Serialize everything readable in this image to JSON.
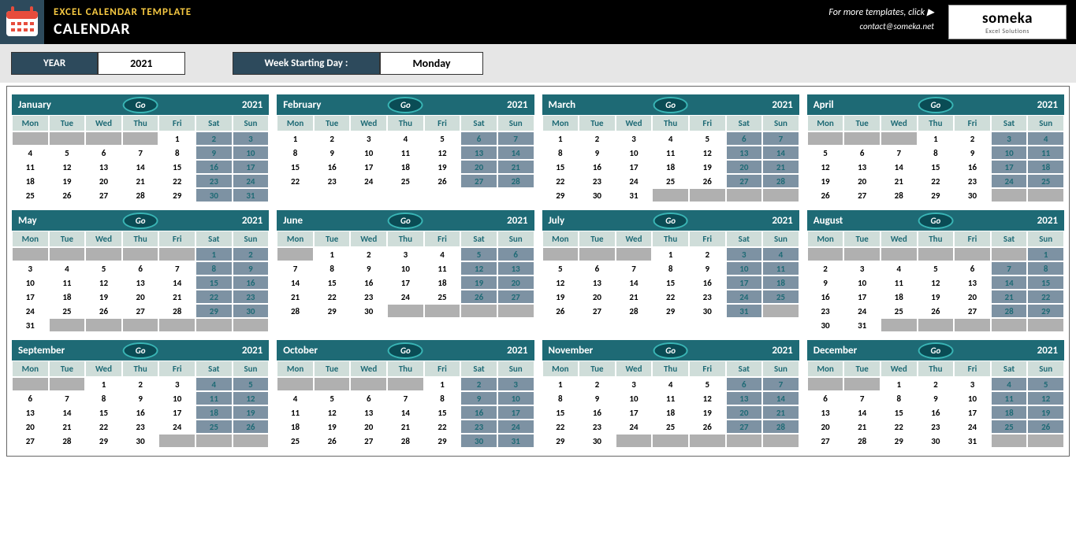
{
  "header": {
    "app_title": "EXCEL CALENDAR TEMPLATE",
    "page_title": "CALENDAR",
    "more_text": "For more templates, click ▶",
    "contact": "contact@someka.net",
    "brand_name": "someka",
    "brand_sub": "Excel Solutions"
  },
  "controls": {
    "year_label": "YEAR",
    "year_value": "2021",
    "weekstart_label": "Week Starting Day :",
    "weekstart_value": "Monday"
  },
  "go_label": "Go",
  "dow": [
    "Mon",
    "Tue",
    "Wed",
    "Thu",
    "Fri",
    "Sat",
    "Sun"
  ],
  "weekend_indices": [
    5,
    6
  ],
  "months": [
    {
      "name": "January",
      "year": "2021",
      "start": 4,
      "days": 31
    },
    {
      "name": "February",
      "year": "2021",
      "start": 0,
      "days": 28
    },
    {
      "name": "March",
      "year": "2021",
      "start": 0,
      "days": 31
    },
    {
      "name": "April",
      "year": "2021",
      "start": 3,
      "days": 30
    },
    {
      "name": "May",
      "year": "2021",
      "start": 5,
      "days": 31
    },
    {
      "name": "June",
      "year": "2021",
      "start": 1,
      "days": 30
    },
    {
      "name": "July",
      "year": "2021",
      "start": 3,
      "days": 31
    },
    {
      "name": "August",
      "year": "2021",
      "start": 6,
      "days": 31
    },
    {
      "name": "September",
      "year": "2021",
      "start": 2,
      "days": 30
    },
    {
      "name": "October",
      "year": "2021",
      "start": 4,
      "days": 31
    },
    {
      "name": "November",
      "year": "2021",
      "start": 0,
      "days": 30
    },
    {
      "name": "December",
      "year": "2021",
      "start": 2,
      "days": 31
    }
  ]
}
